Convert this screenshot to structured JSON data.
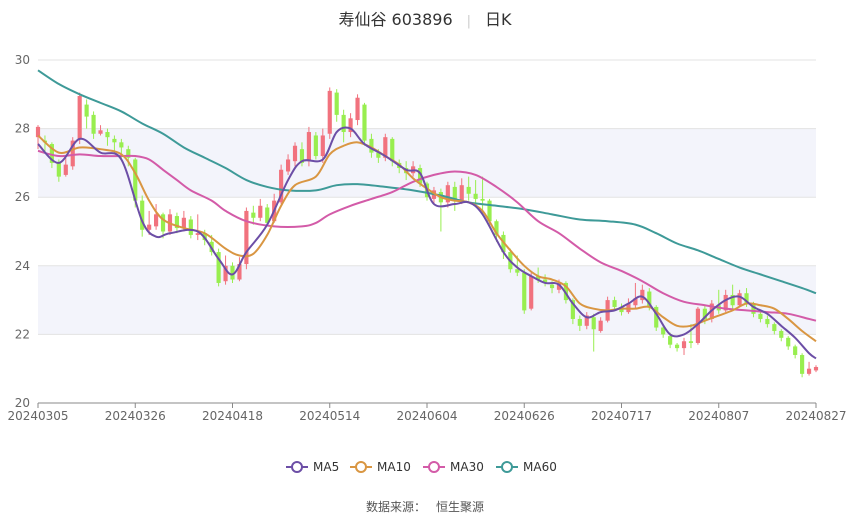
{
  "header": {
    "stock_name": "寿仙谷 603896",
    "period": "日K"
  },
  "source": {
    "label": "数据来源：",
    "value": "恒生聚源"
  },
  "colors": {
    "up": "#f1727e",
    "down": "#98ee4f",
    "ma5": "#6c4ea6",
    "ma10": "#d99642",
    "ma30": "#d35ba8",
    "ma60": "#3e9a98",
    "band": "#f3f4fb",
    "grid": "#e3e3e3"
  },
  "chart_data": {
    "type": "candlestick",
    "yrange": [
      20,
      30
    ],
    "yticks": [
      20,
      22,
      24,
      26,
      28,
      30
    ],
    "xticks": [
      {
        "i": 0,
        "label": "20240305"
      },
      {
        "i": 14,
        "label": "20240326"
      },
      {
        "i": 28,
        "label": "20240418"
      },
      {
        "i": 42,
        "label": "20240514"
      },
      {
        "i": 56,
        "label": "20240604"
      },
      {
        "i": 70,
        "label": "20240626"
      },
      {
        "i": 84,
        "label": "20240717"
      },
      {
        "i": 98,
        "label": "20240807"
      },
      {
        "i": 112,
        "label": "20240827"
      }
    ],
    "legend": [
      {
        "key": "ma5",
        "label": "MA5"
      },
      {
        "key": "ma10",
        "label": "MA10"
      },
      {
        "key": "ma30",
        "label": "MA30"
      },
      {
        "key": "ma60",
        "label": "MA60"
      }
    ],
    "candles": [
      [
        27.75,
        28.05,
        27.4,
        28.1
      ],
      [
        27.65,
        27.6,
        27.3,
        27.8
      ],
      [
        27.55,
        27.0,
        26.85,
        27.6
      ],
      [
        27.0,
        26.6,
        26.45,
        27.1
      ],
      [
        26.65,
        26.95,
        26.6,
        27.15
      ],
      [
        26.9,
        27.65,
        26.8,
        27.75
      ],
      [
        27.7,
        28.95,
        27.55,
        29.05
      ],
      [
        28.7,
        28.35,
        28.0,
        28.85
      ],
      [
        28.4,
        27.85,
        27.7,
        28.5
      ],
      [
        27.85,
        27.95,
        27.8,
        28.1
      ],
      [
        27.9,
        27.75,
        27.5,
        28.0
      ],
      [
        27.7,
        27.6,
        27.3,
        27.8
      ],
      [
        27.6,
        27.45,
        27.1,
        27.7
      ],
      [
        27.4,
        27.15,
        26.9,
        27.5
      ],
      [
        27.1,
        25.9,
        25.7,
        27.15
      ],
      [
        25.9,
        25.05,
        24.85,
        26.05
      ],
      [
        25.05,
        25.2,
        24.9,
        25.6
      ],
      [
        25.15,
        25.5,
        25.05,
        25.8
      ],
      [
        25.5,
        25.0,
        24.8,
        25.55
      ],
      [
        25.0,
        25.5,
        24.9,
        25.65
      ],
      [
        25.45,
        25.1,
        24.95,
        25.55
      ],
      [
        25.1,
        25.4,
        25.0,
        25.6
      ],
      [
        25.35,
        24.9,
        24.8,
        25.45
      ],
      [
        24.9,
        24.95,
        24.75,
        25.5
      ],
      [
        24.95,
        24.75,
        24.6,
        25.05
      ],
      [
        24.7,
        24.4,
        24.3,
        24.9
      ],
      [
        24.4,
        23.5,
        23.4,
        24.5
      ],
      [
        23.55,
        24.0,
        23.45,
        24.3
      ],
      [
        24.0,
        23.6,
        23.5,
        24.1
      ],
      [
        23.6,
        24.05,
        23.55,
        24.25
      ],
      [
        24.05,
        25.6,
        23.9,
        25.7
      ],
      [
        25.55,
        25.4,
        25.2,
        25.75
      ],
      [
        25.4,
        25.75,
        25.3,
        25.95
      ],
      [
        25.7,
        25.25,
        25.15,
        25.8
      ],
      [
        25.3,
        25.9,
        25.25,
        26.1
      ],
      [
        25.85,
        26.8,
        25.8,
        26.95
      ],
      [
        26.75,
        27.1,
        26.65,
        27.25
      ],
      [
        27.05,
        27.5,
        26.9,
        27.6
      ],
      [
        27.4,
        27.0,
        26.9,
        27.6
      ],
      [
        27.05,
        27.9,
        26.9,
        28.05
      ],
      [
        27.8,
        27.2,
        27.1,
        27.9
      ],
      [
        27.2,
        27.8,
        27.0,
        28.0
      ],
      [
        27.85,
        29.1,
        27.7,
        29.2
      ],
      [
        29.05,
        28.4,
        28.2,
        29.15
      ],
      [
        28.4,
        27.9,
        27.6,
        28.55
      ],
      [
        27.9,
        28.3,
        27.75,
        28.45
      ],
      [
        28.25,
        28.9,
        28.1,
        29.0
      ],
      [
        28.7,
        27.65,
        27.5,
        28.75
      ],
      [
        27.7,
        27.3,
        27.15,
        27.85
      ],
      [
        27.3,
        27.15,
        27.0,
        27.4
      ],
      [
        27.15,
        27.75,
        27.05,
        27.85
      ],
      [
        27.7,
        27.05,
        26.9,
        27.75
      ],
      [
        27.0,
        26.85,
        26.7,
        27.1
      ],
      [
        26.85,
        26.7,
        26.5,
        27.05
      ],
      [
        26.7,
        26.9,
        26.6,
        27.05
      ],
      [
        26.85,
        26.4,
        26.3,
        26.95
      ],
      [
        26.4,
        26.0,
        25.9,
        26.45
      ],
      [
        25.95,
        26.2,
        25.8,
        26.3
      ],
      [
        26.15,
        25.85,
        25.0,
        26.25
      ],
      [
        25.85,
        26.35,
        25.7,
        26.45
      ],
      [
        26.3,
        25.9,
        25.6,
        26.45
      ],
      [
        25.9,
        26.35,
        25.8,
        26.55
      ],
      [
        26.3,
        26.1,
        25.9,
        26.6
      ],
      [
        26.1,
        25.95,
        25.8,
        26.5
      ],
      [
        25.95,
        25.9,
        25.5,
        26.6
      ],
      [
        25.9,
        25.3,
        25.2,
        25.95
      ],
      [
        25.3,
        24.9,
        24.7,
        25.35
      ],
      [
        24.9,
        24.4,
        24.2,
        25.0
      ],
      [
        24.4,
        23.9,
        23.8,
        24.5
      ],
      [
        23.9,
        23.8,
        23.7,
        24.3
      ],
      [
        23.8,
        22.7,
        22.6,
        23.9
      ],
      [
        22.75,
        23.7,
        22.7,
        23.8
      ],
      [
        23.7,
        23.6,
        23.5,
        23.95
      ],
      [
        23.6,
        23.5,
        23.4,
        23.75
      ],
      [
        23.45,
        23.35,
        23.2,
        23.55
      ],
      [
        23.3,
        23.5,
        23.2,
        23.6
      ],
      [
        23.5,
        23.0,
        22.9,
        23.55
      ],
      [
        23.0,
        22.45,
        22.3,
        23.05
      ],
      [
        22.45,
        22.25,
        22.1,
        22.55
      ],
      [
        22.25,
        22.55,
        22.15,
        22.65
      ],
      [
        22.5,
        22.15,
        21.5,
        22.6
      ],
      [
        22.1,
        22.4,
        22.05,
        22.5
      ],
      [
        22.4,
        23.0,
        22.35,
        23.1
      ],
      [
        23.0,
        22.8,
        22.7,
        23.1
      ],
      [
        22.8,
        22.65,
        22.55,
        22.9
      ],
      [
        22.65,
        22.9,
        22.6,
        23.05
      ],
      [
        22.85,
        23.05,
        22.75,
        23.5
      ],
      [
        23.0,
        23.3,
        22.9,
        23.45
      ],
      [
        23.25,
        22.8,
        22.7,
        23.35
      ],
      [
        22.8,
        22.2,
        22.1,
        22.85
      ],
      [
        22.2,
        22.0,
        21.9,
        22.25
      ],
      [
        21.95,
        21.7,
        21.6,
        22.05
      ],
      [
        21.7,
        21.6,
        21.5,
        21.75
      ],
      [
        21.6,
        21.8,
        21.4,
        21.9
      ],
      [
        21.8,
        21.75,
        21.6,
        22.3
      ],
      [
        21.75,
        22.75,
        21.7,
        22.8
      ],
      [
        22.75,
        22.45,
        22.3,
        22.85
      ],
      [
        22.45,
        22.9,
        22.35,
        23.0
      ],
      [
        22.85,
        22.7,
        22.6,
        23.3
      ],
      [
        22.7,
        23.15,
        22.65,
        23.3
      ],
      [
        23.15,
        22.85,
        22.75,
        23.45
      ],
      [
        22.85,
        23.2,
        22.8,
        23.3
      ],
      [
        23.2,
        22.9,
        22.8,
        23.35
      ],
      [
        22.9,
        22.6,
        22.5,
        22.95
      ],
      [
        22.6,
        22.45,
        22.35,
        22.7
      ],
      [
        22.45,
        22.3,
        22.2,
        22.55
      ],
      [
        22.3,
        22.1,
        22.0,
        22.35
      ],
      [
        22.1,
        21.9,
        21.8,
        22.15
      ],
      [
        21.9,
        21.65,
        21.55,
        21.95
      ],
      [
        21.65,
        21.4,
        21.3,
        21.7
      ],
      [
        21.4,
        20.85,
        20.75,
        21.45
      ],
      [
        20.85,
        21.0,
        20.8,
        21.2
      ],
      [
        20.95,
        21.05,
        20.9,
        21.1
      ]
    ],
    "ma_points": {
      "ma5": [
        [
          0,
          27.55
        ],
        [
          3,
          27.0
        ],
        [
          6,
          27.7
        ],
        [
          9,
          27.3
        ],
        [
          12,
          27.1
        ],
        [
          15,
          25.3
        ],
        [
          17,
          24.85
        ],
        [
          19,
          24.95
        ],
        [
          23,
          25.0
        ],
        [
          26,
          24.2
        ],
        [
          28,
          23.75
        ],
        [
          30,
          24.4
        ],
        [
          33,
          25.2
        ],
        [
          36,
          26.5
        ],
        [
          38,
          27.05
        ],
        [
          41,
          27.1
        ],
        [
          43,
          27.9
        ],
        [
          45,
          28.0
        ],
        [
          47,
          27.55
        ],
        [
          50,
          27.2
        ],
        [
          53,
          26.8
        ],
        [
          55,
          26.7
        ],
        [
          57,
          25.8
        ],
        [
          60,
          25.8
        ],
        [
          62,
          25.85
        ],
        [
          64,
          25.5
        ],
        [
          67,
          24.4
        ],
        [
          69,
          23.95
        ],
        [
          71,
          23.7
        ],
        [
          73,
          23.5
        ],
        [
          75,
          23.45
        ],
        [
          77,
          22.9
        ],
        [
          79,
          22.5
        ],
        [
          81,
          22.65
        ],
        [
          83,
          22.7
        ],
        [
          85,
          22.9
        ],
        [
          87,
          23.1
        ],
        [
          89,
          22.6
        ],
        [
          91,
          22.0
        ],
        [
          93,
          22.0
        ],
        [
          95,
          22.3
        ],
        [
          97,
          22.7
        ],
        [
          99,
          23.0
        ],
        [
          101,
          23.1
        ],
        [
          103,
          22.8
        ],
        [
          105,
          22.6
        ],
        [
          107,
          22.25
        ],
        [
          109,
          21.9
        ],
        [
          111,
          21.45
        ],
        [
          112,
          21.3
        ]
      ],
      "ma10": [
        [
          0,
          27.8
        ],
        [
          3,
          27.3
        ],
        [
          6,
          27.45
        ],
        [
          9,
          27.4
        ],
        [
          12,
          27.25
        ],
        [
          14,
          26.7
        ],
        [
          16,
          25.9
        ],
        [
          18,
          25.35
        ],
        [
          21,
          25.1
        ],
        [
          24,
          24.95
        ],
        [
          27,
          24.5
        ],
        [
          29,
          24.3
        ],
        [
          31,
          24.35
        ],
        [
          33,
          24.9
        ],
        [
          35,
          25.75
        ],
        [
          37,
          26.35
        ],
        [
          40,
          26.6
        ],
        [
          42,
          27.25
        ],
        [
          44,
          27.5
        ],
        [
          46,
          27.6
        ],
        [
          48,
          27.45
        ],
        [
          50,
          27.2
        ],
        [
          52,
          26.95
        ],
        [
          54,
          26.55
        ],
        [
          56,
          26.25
        ],
        [
          58,
          26.0
        ],
        [
          60,
          25.9
        ],
        [
          62,
          25.85
        ],
        [
          64,
          25.6
        ],
        [
          66,
          24.95
        ],
        [
          68,
          24.45
        ],
        [
          70,
          24.0
        ],
        [
          72,
          23.7
        ],
        [
          74,
          23.6
        ],
        [
          76,
          23.4
        ],
        [
          78,
          22.9
        ],
        [
          80,
          22.75
        ],
        [
          82,
          22.7
        ],
        [
          84,
          22.75
        ],
        [
          86,
          22.75
        ],
        [
          88,
          22.8
        ],
        [
          90,
          22.5
        ],
        [
          92,
          22.25
        ],
        [
          94,
          22.25
        ],
        [
          96,
          22.4
        ],
        [
          98,
          22.55
        ],
        [
          100,
          22.7
        ],
        [
          102,
          22.9
        ],
        [
          104,
          22.85
        ],
        [
          106,
          22.75
        ],
        [
          108,
          22.45
        ],
        [
          110,
          22.1
        ],
        [
          112,
          21.8
        ]
      ],
      "ma30": [
        [
          0,
          27.35
        ],
        [
          3,
          27.2
        ],
        [
          6,
          27.25
        ],
        [
          9,
          27.2
        ],
        [
          12,
          27.2
        ],
        [
          14,
          27.2
        ],
        [
          16,
          27.1
        ],
        [
          18,
          26.8
        ],
        [
          20,
          26.5
        ],
        [
          22,
          26.2
        ],
        [
          25,
          25.9
        ],
        [
          27,
          25.6
        ],
        [
          30,
          25.3
        ],
        [
          34,
          25.15
        ],
        [
          38,
          25.15
        ],
        [
          40,
          25.25
        ],
        [
          42,
          25.5
        ],
        [
          45,
          25.75
        ],
        [
          48,
          25.95
        ],
        [
          51,
          26.15
        ],
        [
          54,
          26.45
        ],
        [
          57,
          26.65
        ],
        [
          60,
          26.75
        ],
        [
          63,
          26.65
        ],
        [
          66,
          26.3
        ],
        [
          69,
          25.85
        ],
        [
          72,
          25.3
        ],
        [
          75,
          24.95
        ],
        [
          78,
          24.5
        ],
        [
          81,
          24.1
        ],
        [
          84,
          23.85
        ],
        [
          87,
          23.55
        ],
        [
          90,
          23.2
        ],
        [
          93,
          22.95
        ],
        [
          96,
          22.85
        ],
        [
          99,
          22.75
        ],
        [
          102,
          22.7
        ],
        [
          105,
          22.65
        ],
        [
          108,
          22.6
        ],
        [
          111,
          22.45
        ],
        [
          112,
          22.4
        ]
      ],
      "ma60": [
        [
          0,
          29.7
        ],
        [
          3,
          29.3
        ],
        [
          6,
          29.0
        ],
        [
          9,
          28.75
        ],
        [
          12,
          28.5
        ],
        [
          15,
          28.15
        ],
        [
          18,
          27.85
        ],
        [
          21,
          27.45
        ],
        [
          24,
          27.15
        ],
        [
          27,
          26.85
        ],
        [
          30,
          26.5
        ],
        [
          33,
          26.3
        ],
        [
          36,
          26.2
        ],
        [
          40,
          26.2
        ],
        [
          43,
          26.35
        ],
        [
          46,
          26.38
        ],
        [
          50,
          26.3
        ],
        [
          54,
          26.2
        ],
        [
          58,
          26.05
        ],
        [
          62,
          25.85
        ],
        [
          66,
          25.75
        ],
        [
          70,
          25.65
        ],
        [
          74,
          25.5
        ],
        [
          78,
          25.35
        ],
        [
          82,
          25.3
        ],
        [
          86,
          25.2
        ],
        [
          89,
          24.95
        ],
        [
          92,
          24.65
        ],
        [
          95,
          24.45
        ],
        [
          98,
          24.2
        ],
        [
          101,
          23.95
        ],
        [
          104,
          23.75
        ],
        [
          107,
          23.55
        ],
        [
          110,
          23.35
        ],
        [
          112,
          23.2
        ]
      ]
    }
  }
}
